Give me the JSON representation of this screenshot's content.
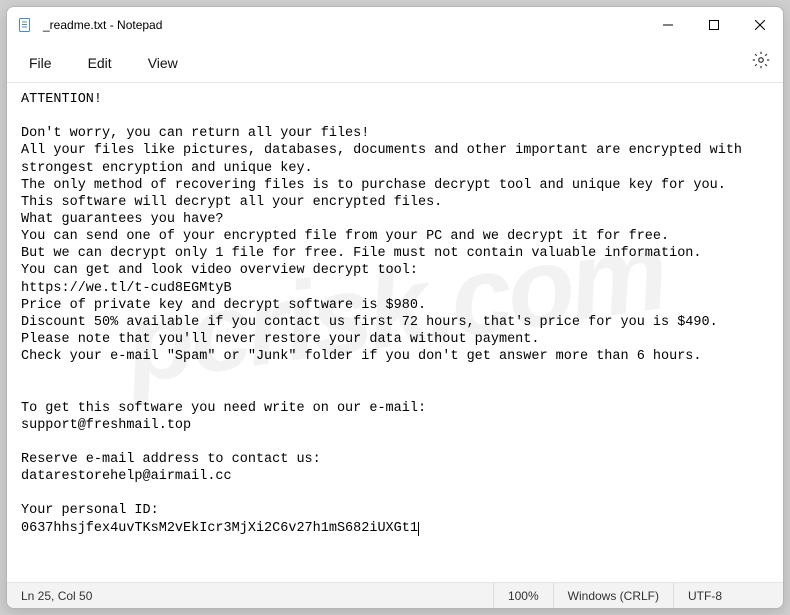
{
  "titlebar": {
    "title": "_readme.txt - Notepad"
  },
  "menubar": {
    "file": "File",
    "edit": "Edit",
    "view": "View"
  },
  "content": {
    "text": "ATTENTION!\n\nDon't worry, you can return all your files!\nAll your files like pictures, databases, documents and other important are encrypted with strongest encryption and unique key.\nThe only method of recovering files is to purchase decrypt tool and unique key for you.\nThis software will decrypt all your encrypted files.\nWhat guarantees you have?\nYou can send one of your encrypted file from your PC and we decrypt it for free.\nBut we can decrypt only 1 file for free. File must not contain valuable information.\nYou can get and look video overview decrypt tool:\nhttps://we.tl/t-cud8EGMtyB\nPrice of private key and decrypt software is $980.\nDiscount 50% available if you contact us first 72 hours, that's price for you is $490.\nPlease note that you'll never restore your data without payment.\nCheck your e-mail \"Spam\" or \"Junk\" folder if you don't get answer more than 6 hours.\n\n\nTo get this software you need write on our e-mail:\nsupport@freshmail.top\n\nReserve e-mail address to contact us:\ndatarestorehelp@airmail.cc\n\nYour personal ID:\n0637hhsjfex4uvTKsM2vEkIcr3MjXi2C6v27h1mS682iUXGt1"
  },
  "statusbar": {
    "position": "Ln 25, Col 50",
    "zoom": "100%",
    "eol": "Windows (CRLF)",
    "encoding": "UTF-8"
  },
  "watermark": "pcrisk.com"
}
